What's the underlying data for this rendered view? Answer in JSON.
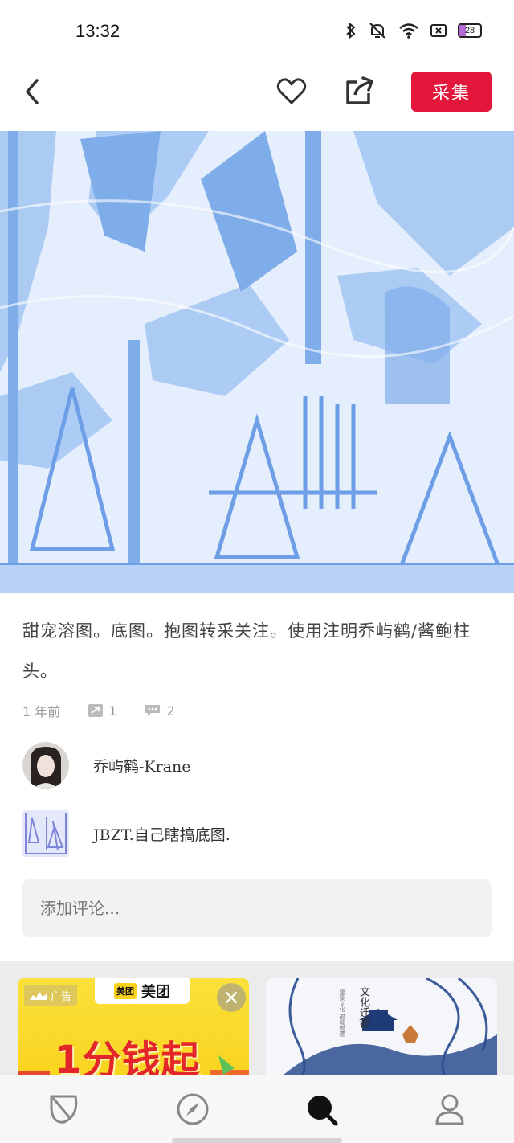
{
  "status_bar": {
    "time": "13:32",
    "battery": "28",
    "icons": [
      "bluetooth-icon",
      "mute-bell-icon",
      "wifi-icon",
      "screenshot-icon",
      "battery-icon"
    ]
  },
  "top_nav": {
    "collect_label": "采集",
    "icons": [
      "back-arrow-icon",
      "heart-icon",
      "share-icon"
    ]
  },
  "pin": {
    "description": "甜宠溶图。底图。抱图转采关注。使用注明乔屿鹤/酱鲍柱头。",
    "time_ago": "1 年前",
    "repin_count": "1",
    "comment_count": "2"
  },
  "author": {
    "name": "乔屿鹤-Krane"
  },
  "board": {
    "name": "JBZT.自己瞎搞底图."
  },
  "comment_input": {
    "placeholder": "添加评论..."
  },
  "feed": {
    "ad": {
      "tag": "广告",
      "brand_logo": "美团",
      "brand_name": "美团",
      "headline": "1分钱起"
    },
    "art": {
      "title": "文化迁都",
      "subtitle": "建築文化 都城變遷"
    }
  },
  "bottom_nav": {
    "items": [
      "leaf-icon",
      "compass-icon",
      "search-icon",
      "profile-icon"
    ]
  },
  "colors": {
    "accent": "#e3163b",
    "image_blue": "#8fb8ee"
  }
}
